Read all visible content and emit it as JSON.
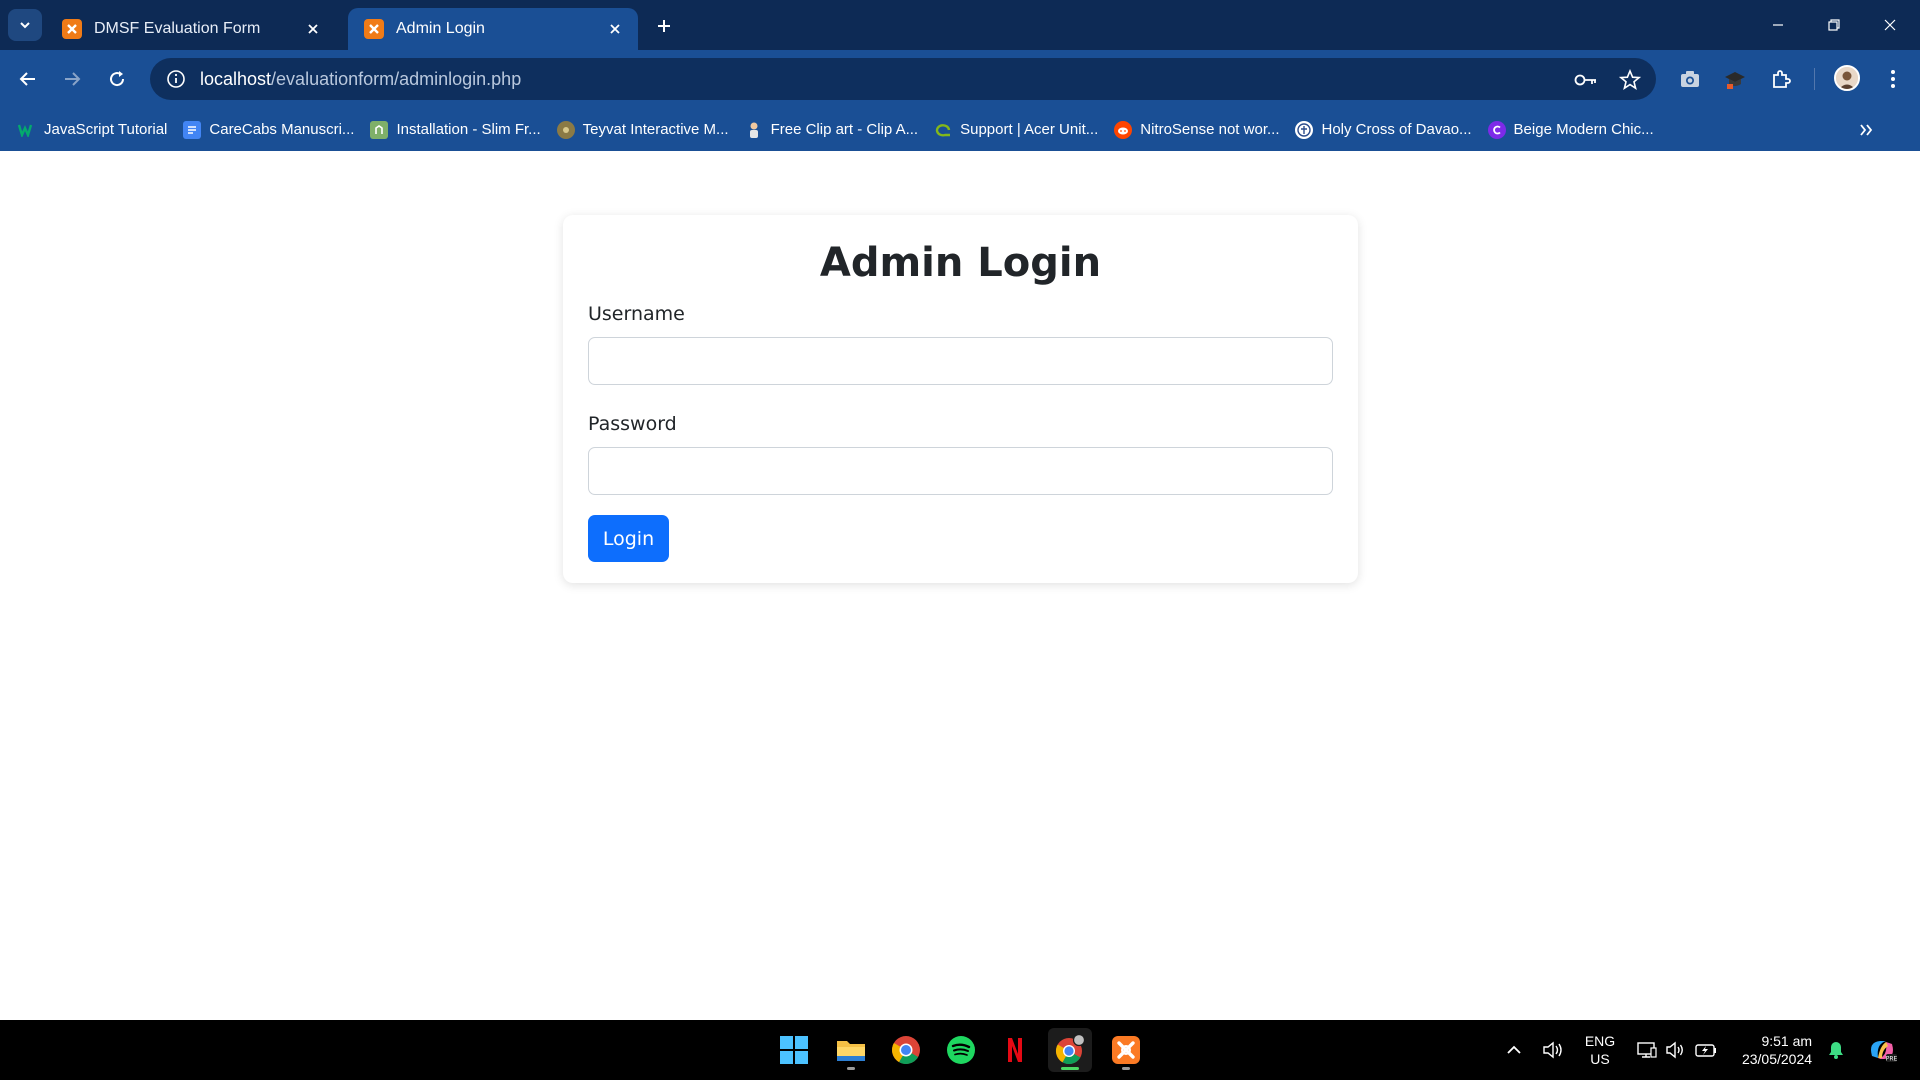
{
  "browser": {
    "tabs": [
      {
        "title": "DMSF Evaluation Form",
        "active": false
      },
      {
        "title": "Admin Login",
        "active": true
      }
    ],
    "address": {
      "host": "localhost",
      "path": "/evaluationform/adminlogin.php"
    },
    "bookmarks": [
      {
        "label": "JavaScript Tutorial",
        "icon": "w3schools-icon"
      },
      {
        "label": "CareCabs Manuscri...",
        "icon": "docs-icon"
      },
      {
        "label": "Installation - Slim Fr...",
        "icon": "slim-icon"
      },
      {
        "label": "Teyvat Interactive M...",
        "icon": "map-icon"
      },
      {
        "label": "Free Clip art - Clip A...",
        "icon": "clipart-icon"
      },
      {
        "label": "Support | Acer Unit...",
        "icon": "acer-icon"
      },
      {
        "label": "NitroSense not wor...",
        "icon": "reddit-icon"
      },
      {
        "label": "Holy Cross of Davao...",
        "icon": "school-icon"
      },
      {
        "label": "Beige Modern Chic...",
        "icon": "canva-icon"
      }
    ]
  },
  "page": {
    "title": "Admin Login",
    "username_label": "Username",
    "username_value": "",
    "password_label": "Password",
    "password_value": "",
    "login_label": "Login"
  },
  "taskbar": {
    "apps": [
      "windows-start-icon",
      "file-explorer-icon",
      "chrome-icon",
      "spotify-icon",
      "netflix-icon",
      "chrome-profile-icon",
      "xampp-icon"
    ],
    "language": "ENG",
    "region": "US",
    "time": "9:51 am",
    "date": "23/05/2024"
  },
  "colors": {
    "tab_strip": "#0d2a55",
    "toolbar": "#1a4f95",
    "omnibox": "#0e2f5e",
    "primary_button": "#0d6efd",
    "xampp_orange": "#f07b17"
  }
}
